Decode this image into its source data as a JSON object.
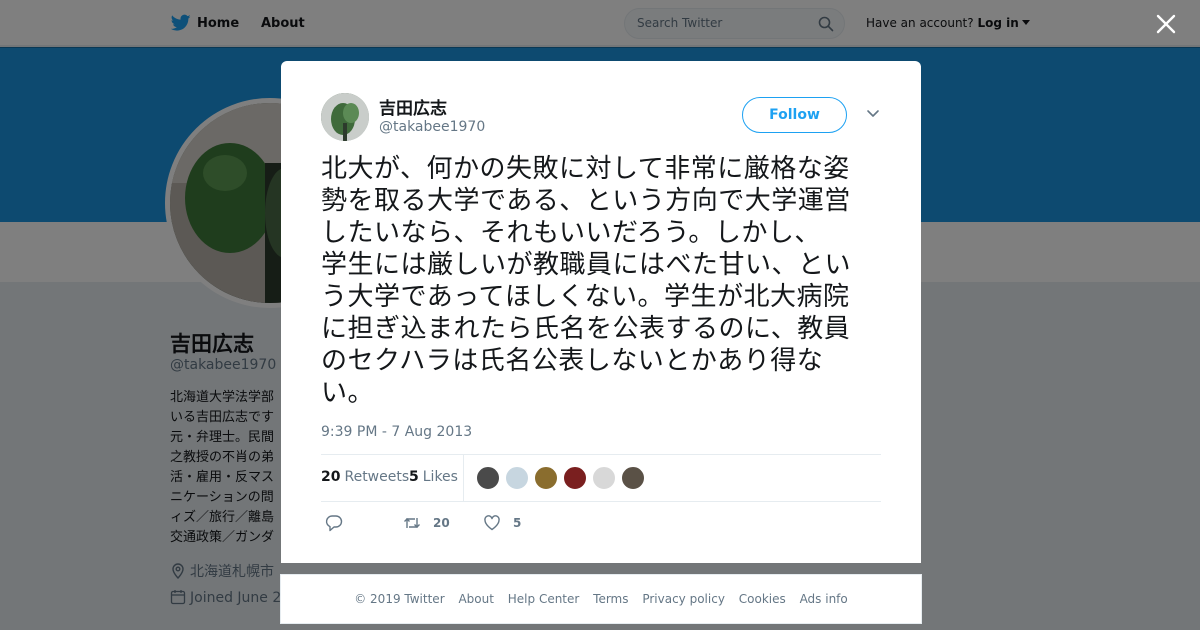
{
  "nav": {
    "home_label": "Home",
    "about_label": "About",
    "search_placeholder": "Search Twitter",
    "account_prompt": "Have an account?",
    "login_label": "Log in"
  },
  "profile": {
    "name": "吉田広志",
    "handle": "@takabee1970",
    "bio_lines": [
      "北海道大学法学部",
      "いる吉田広志です",
      "元・弁理士。民間",
      "之教授の不肖の弟",
      "活・雇用・反マス",
      "ニケーションの問",
      "ィズ／旅行／離島",
      "交通政策／ガンダ"
    ],
    "location": "北海道札幌市",
    "joined": "Joined June 2"
  },
  "tweet": {
    "name": "吉田広志",
    "handle": "@takabee1970",
    "follow_label": "Follow",
    "text_lines": [
      "北大が、何かの失敗に対して非常に厳格な姿",
      "勢を取る大学である、という方向で大学運営",
      "したいなら、それもいいだろう。しかし、",
      "学生には厳しいが教職員にはべた甘い、とい",
      "う大学であってほしくない。学生が北大病院",
      "に担ぎ込まれたら氏名を公表するのに、教員",
      "のセクハラは氏名公表しないとかあり得な",
      "い。"
    ],
    "timestamp": "9:39 PM - 7 Aug 2013",
    "retweets_count": "20",
    "retweets_label": "Retweets",
    "likes_count": "5",
    "likes_label": "Likes",
    "action_retweet_count": "20",
    "action_like_count": "5",
    "liker_colors": [
      "#4a4a4a",
      "#c7d6e0",
      "#8a6d2e",
      "#7a1f1f",
      "#d8d8d8",
      "#5a5146"
    ]
  },
  "footer": {
    "copyright": "© 2019 Twitter",
    "about": "About",
    "help": "Help Center",
    "terms": "Terms",
    "privacy": "Privacy policy",
    "cookies": "Cookies",
    "ads": "Ads info"
  },
  "colors": {
    "brand": "#1da1f2",
    "banner": "#1b95e0"
  }
}
